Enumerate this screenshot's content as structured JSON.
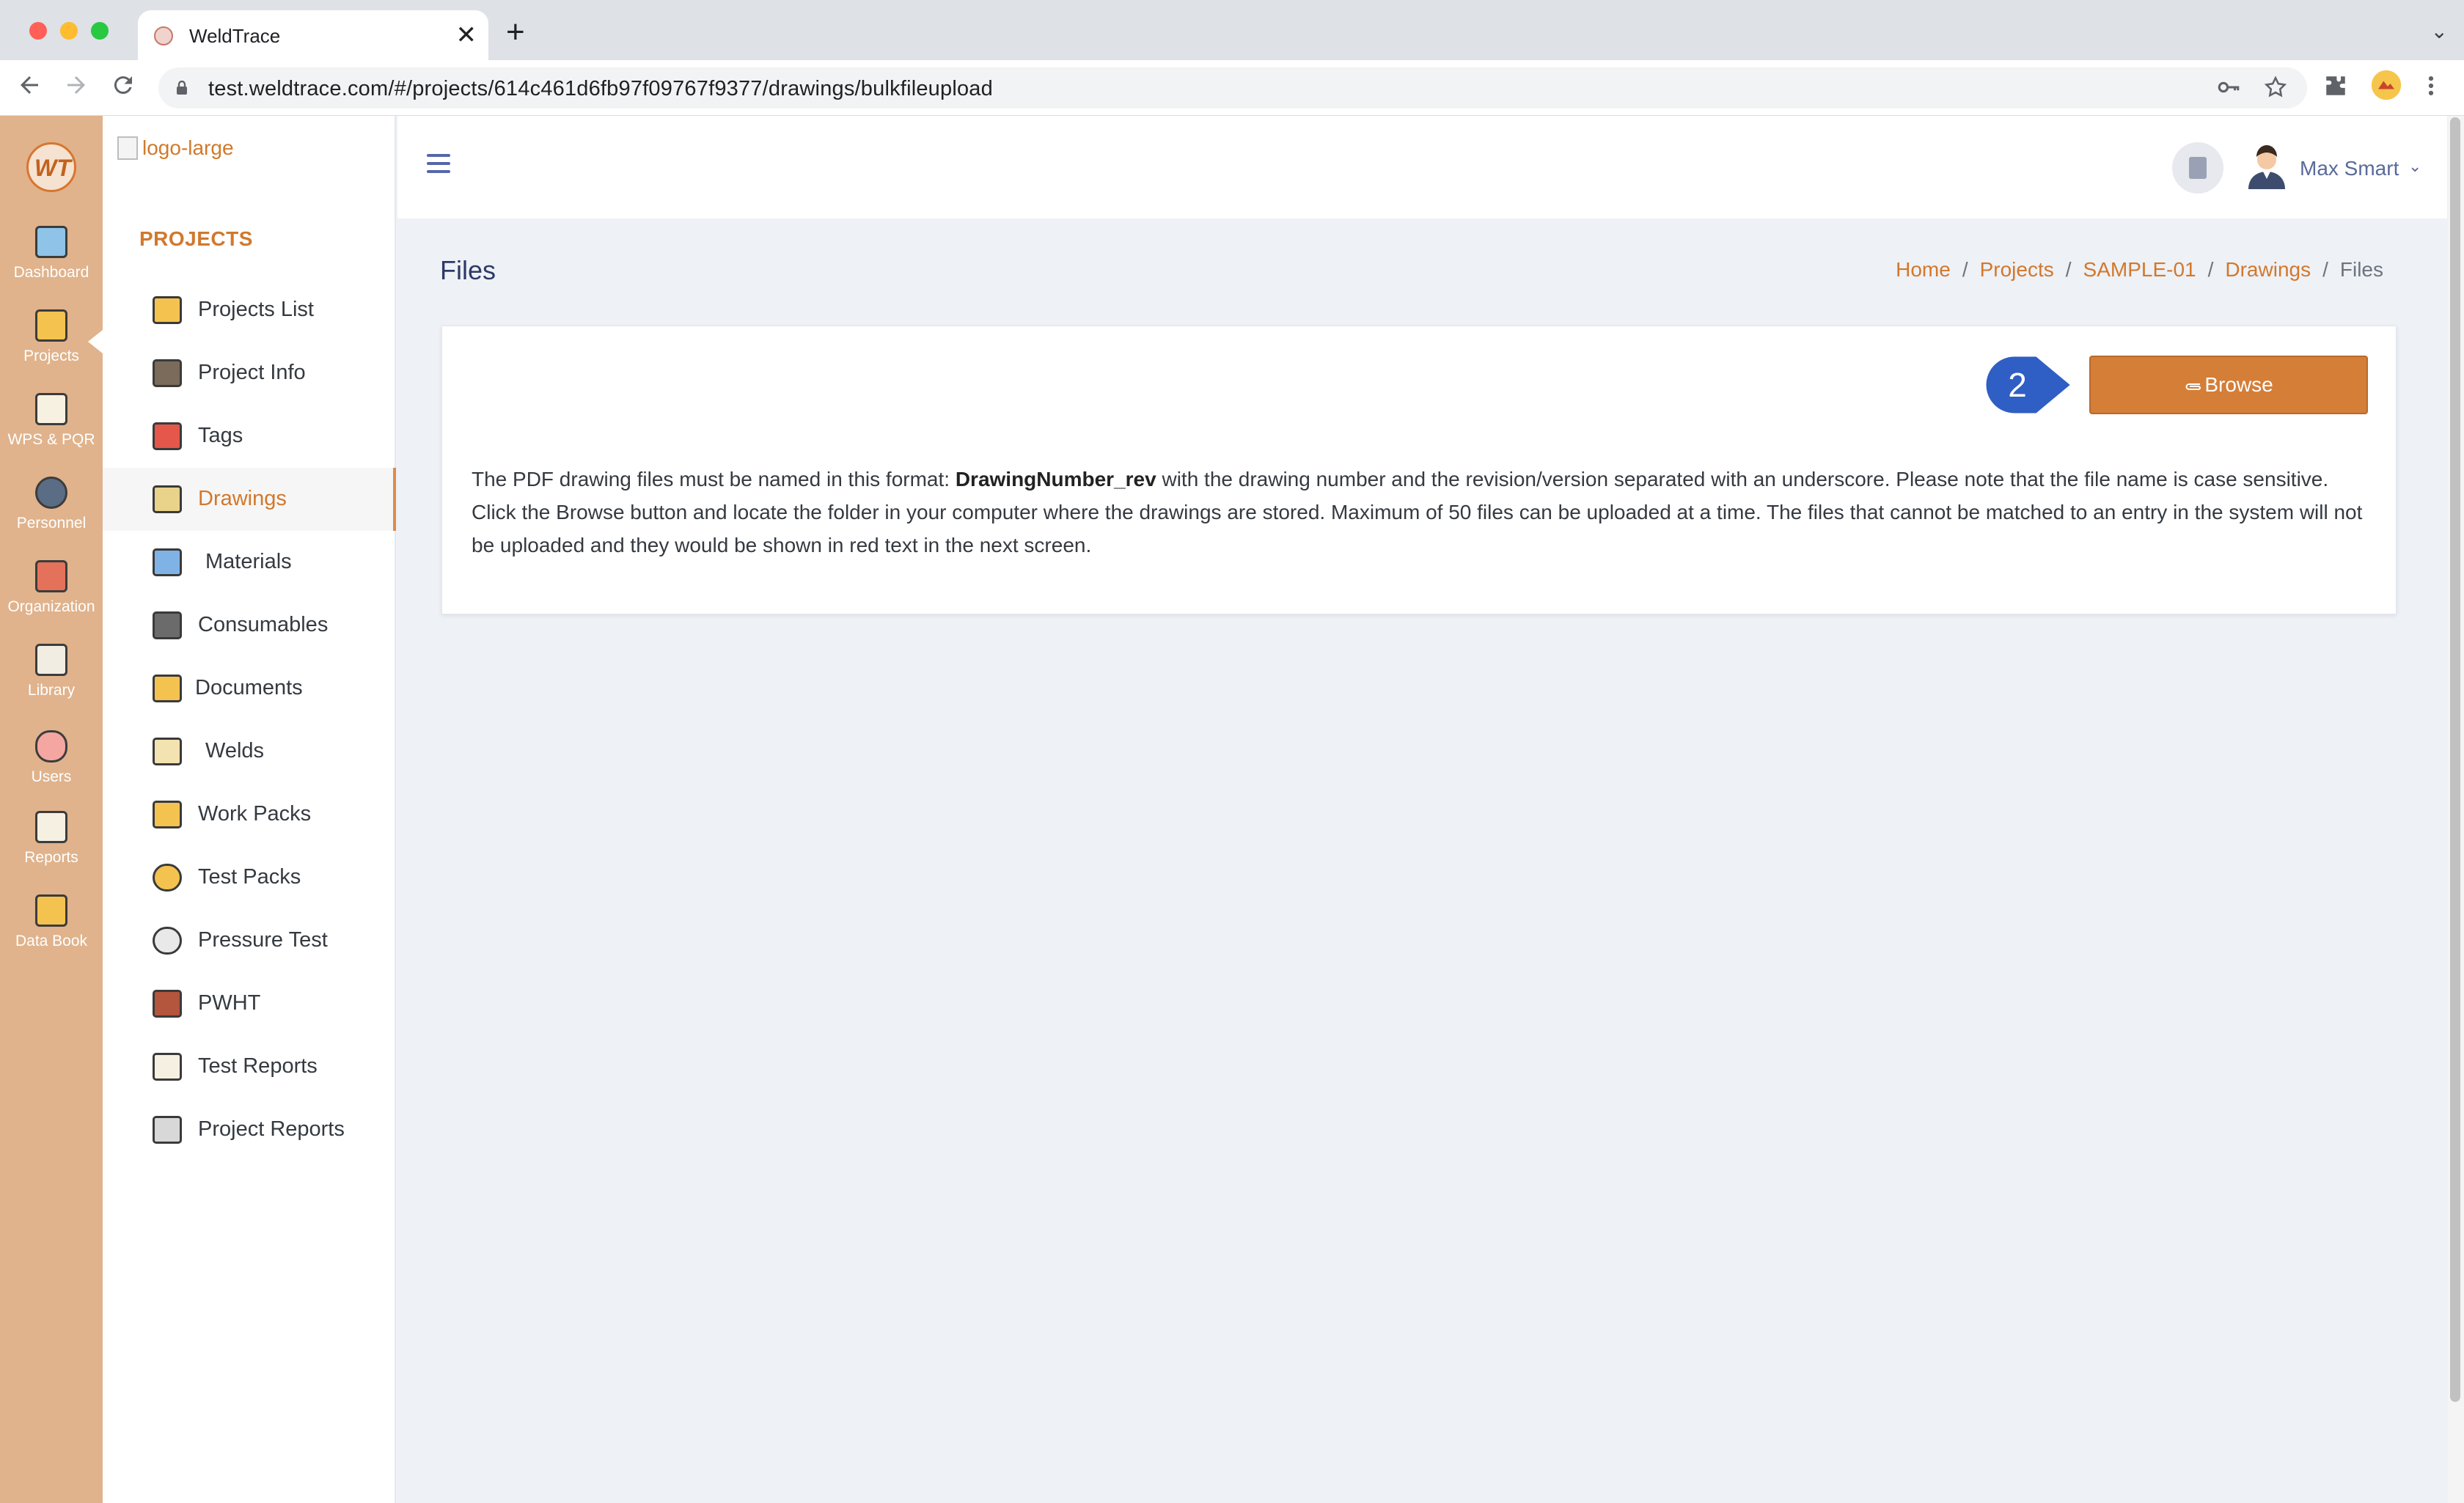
{
  "browser": {
    "tab_title": "WeldTrace",
    "tab_close": "✕",
    "new_tab": "+",
    "tab_menu": "⌄",
    "url": "test.weldtrace.com/#/projects/614c461d6fb97f09767f9377/drawings/bulkfileupload",
    "icons": [
      "back-icon",
      "forward-icon",
      "reload-icon",
      "lock-icon",
      "key-icon",
      "star-icon",
      "extensions-icon",
      "profile-icon",
      "more-icon"
    ]
  },
  "rail": {
    "logo_text": "WT",
    "items": [
      {
        "label": "Dashboard"
      },
      {
        "label": "Projects"
      },
      {
        "label": "WPS & PQR"
      },
      {
        "label": "Personnel"
      },
      {
        "label": "Organization"
      },
      {
        "label": "Library"
      },
      {
        "label": "Users"
      },
      {
        "label": "Reports"
      },
      {
        "label": "Data Book"
      }
    ]
  },
  "sidebar": {
    "logo_alt": "logo-large",
    "section_title": "PROJECTS",
    "active_item": "Drawings",
    "items": [
      {
        "label": "Projects List"
      },
      {
        "label": "Project Info"
      },
      {
        "label": "Tags"
      },
      {
        "label": "Drawings"
      },
      {
        "label": "Materials"
      },
      {
        "label": "Consumables"
      },
      {
        "label": "Documents"
      },
      {
        "label": "Welds"
      },
      {
        "label": "Work Packs"
      },
      {
        "label": "Test Packs"
      },
      {
        "label": "Pressure Test"
      },
      {
        "label": "PWHT"
      },
      {
        "label": "Test Reports"
      },
      {
        "label": "Project Reports"
      }
    ]
  },
  "header": {
    "user_name": "Max Smart",
    "user_caret": "⌄"
  },
  "page": {
    "title": "Files",
    "breadcrumb": [
      "Home",
      "Projects",
      "SAMPLE-01",
      "Drawings",
      "Files"
    ],
    "breadcrumb_sep": "/"
  },
  "card": {
    "browse_label": "Browse",
    "step_number": "2",
    "text_before": "The PDF drawing files must be named in this format: ",
    "text_bold": "DrawingNumber_rev",
    "text_after": " with the drawing number and the revision/version separated with an underscore. Please note that the file name is case sensitive. Click the Browse button and locate the folder in your computer where the drawings are stored. Maximum of 50 files can be uploaded at a time. The files that cannot be matched to an entry in the system will not be uploaded and they would be shown in red text in the next screen."
  },
  "colors": {
    "accent": "#d2782c",
    "rail": "#e0b38c",
    "step_badge": "#2f5ec4",
    "page_bg": "#eef1f6"
  }
}
